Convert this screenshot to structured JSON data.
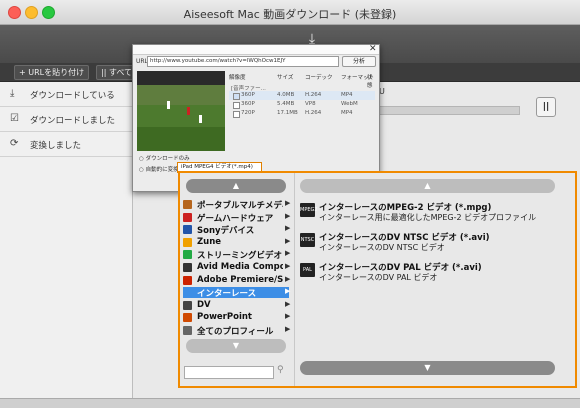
{
  "window": {
    "title": "Aiseesoft Mac 動画ダウンロード (未登録)"
  },
  "toolbar": {
    "paste_url": "+ URLを貼り付け",
    "pause_all": "|| すべて"
  },
  "sidebar": {
    "items": [
      {
        "label": "ダウンロードしている",
        "icon": "download-icon"
      },
      {
        "label": "ダウンロードしました",
        "icon": "downloaded-icon"
      },
      {
        "label": "変換しました",
        "icon": "converted-icon"
      }
    ]
  },
  "progress": {
    "text": "U",
    "pause_label": "||"
  },
  "dialog": {
    "url_label": "URL:",
    "url_value": "http://www.youtube.com/watch?v=lWQhOcw1EJY",
    "analyze_button": "分析",
    "columns": [
      "解像度",
      "サイズ",
      "コーデック",
      "フォーマット",
      "状態"
    ],
    "group_label": "[音声ファー...",
    "rows": [
      {
        "res": "360P",
        "size": "4.0MB",
        "codec": "H.264",
        "format": "MP4",
        "checked": true
      },
      {
        "res": "360P",
        "size": "5.4MB",
        "codec": "VP8",
        "format": "WebM",
        "checked": false
      },
      {
        "res": "720P",
        "size": "17.1MB",
        "codec": "H.264",
        "format": "MP4",
        "checked": false
      }
    ],
    "option_download_only": "ダウンロードのみ",
    "option_auto_convert": "自動的に変換",
    "selected_profile": "iPad MPEG4 ビデオ(*.mp4)"
  },
  "popup": {
    "categories": [
      {
        "label": "ポータブルマルチメディ...",
        "color": "#b5651d"
      },
      {
        "label": "ゲームハードウェア",
        "color": "#cc2222"
      },
      {
        "label": "Sonyデバイス",
        "color": "#2255aa"
      },
      {
        "label": "Zune",
        "color": "#f0a000"
      },
      {
        "label": "ストリーミングビデオ",
        "color": "#22aa44"
      },
      {
        "label": "Avid Media Composer",
        "color": "#333333"
      },
      {
        "label": "Adobe Premiere/Son...",
        "color": "#cc2200"
      },
      {
        "label": "インターレース",
        "color": "#3d8ee6",
        "selected": true
      },
      {
        "label": "DV",
        "color": "#444444"
      },
      {
        "label": "PowerPoint",
        "color": "#d04a02"
      },
      {
        "label": "全てのプロフィール",
        "color": "#666666"
      }
    ],
    "profiles": [
      {
        "title": "インターレースのMPEG-2 ビデオ (*.mpg)",
        "desc": "インターレース用に最適化したMPEG-2 ビデオプロファイル",
        "badge": "MPEG2"
      },
      {
        "title": "インターレースのDV NTSC ビデオ (*.avi)",
        "desc": "インターレースのDV NTSC ビデオ",
        "badge": "NTSC"
      },
      {
        "title": "インターレースのDV PAL ビデオ (*.avi)",
        "desc": "インターレースのDV PAL ビデオ",
        "badge": "PAL"
      }
    ]
  }
}
